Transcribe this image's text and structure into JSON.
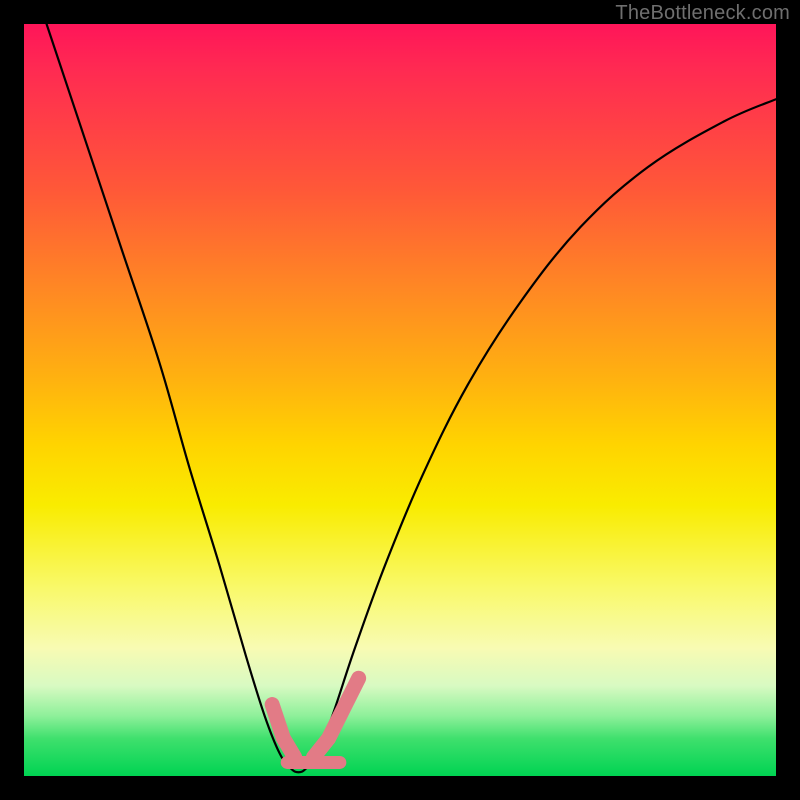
{
  "watermark": "TheBottleneck.com",
  "chart_data": {
    "type": "line",
    "title": "",
    "xlabel": "",
    "ylabel": "",
    "xlim": [
      0,
      100
    ],
    "ylim": [
      0,
      100
    ],
    "grid": false,
    "series": [
      {
        "name": "bottleneck-curve",
        "x": [
          3,
          8,
          13,
          18,
          22,
          26,
          29.5,
          32,
          34,
          35.5,
          36.5,
          37.5,
          39,
          41,
          44,
          48,
          53,
          59,
          66,
          74,
          83,
          93,
          100
        ],
        "values": [
          100,
          85,
          70,
          55,
          41,
          28,
          16,
          8,
          3,
          1,
          0.5,
          1,
          3,
          8,
          17,
          28,
          40,
          52,
          63,
          73,
          81,
          87,
          90
        ]
      }
    ],
    "highlight_segments": [
      {
        "name": "left-brace",
        "x": [
          33.0,
          34.5,
          36.0
        ],
        "y": [
          9.5,
          5.0,
          2.5
        ]
      },
      {
        "name": "right-brace",
        "x": [
          38.5,
          40.5,
          42.5,
          44.5
        ],
        "y": [
          2.5,
          5.0,
          9.0,
          13.0
        ]
      },
      {
        "name": "floor",
        "x": [
          35.0,
          38.5,
          42.0
        ],
        "y": [
          1.8,
          1.8,
          1.8
        ]
      }
    ],
    "highlight_color": "#e27b86",
    "curve_color": "#000000",
    "background_gradient": [
      "#ff1559",
      "#ff2a52",
      "#ff5838",
      "#ff8724",
      "#ffb110",
      "#ffd400",
      "#f9ec00",
      "#f9f96a",
      "#f8fbb3",
      "#d8fac2",
      "#8ef09a",
      "#3fe06d",
      "#00d352"
    ]
  }
}
